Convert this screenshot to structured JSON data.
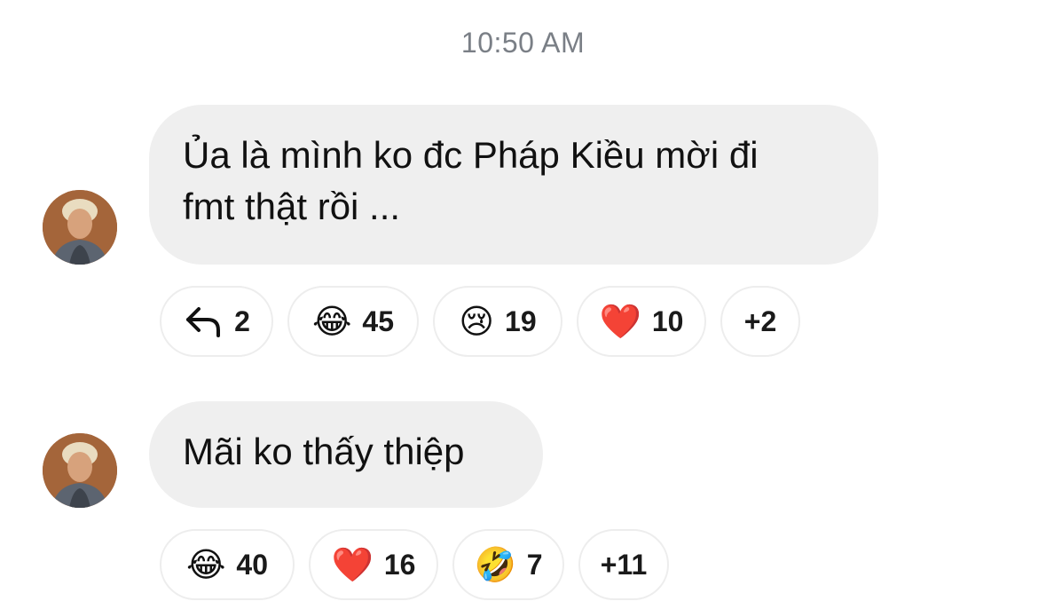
{
  "timestamp": "10:50 AM",
  "messages": [
    {
      "lines": [
        "Ủa là mình ko đc Pháp Kiều mời đi",
        "fmt thật rồi ..."
      ],
      "reply_count": "2",
      "reactions": [
        {
          "emoji": "😂",
          "icon": "face-with-tears-of-joy-icon",
          "count": "45"
        },
        {
          "emoji": "😢",
          "icon": "crying-face-icon",
          "count": "19"
        },
        {
          "emoji": "❤️",
          "icon": "red-heart-icon",
          "count": "10"
        }
      ],
      "more": "+2"
    },
    {
      "lines": [
        "Mãi ko thấy thiệp"
      ],
      "reactions": [
        {
          "emoji": "😂",
          "icon": "face-with-tears-of-joy-icon",
          "count": "40"
        },
        {
          "emoji": "❤️",
          "icon": "red-heart-icon",
          "count": "16"
        },
        {
          "emoji": "🤣",
          "icon": "rolling-on-floor-laughing-icon",
          "count": "7"
        }
      ],
      "more": "+11"
    }
  ],
  "colors": {
    "bubble": "#efefef",
    "timestamp": "#7a7f86",
    "chip_border": "#ededed"
  }
}
